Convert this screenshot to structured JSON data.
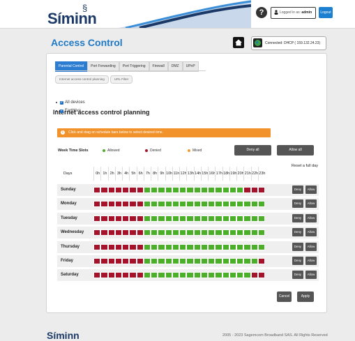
{
  "header": {
    "logo": "Síminn",
    "help": "?",
    "login_prefix": "Logged in as",
    "user": "admin",
    "logout": "Logout"
  },
  "page": {
    "title": "Access Control",
    "connection": "Connected: DHCP ( 159.132.24.23)"
  },
  "tabs": [
    {
      "label": "Parental Control",
      "active": true
    },
    {
      "label": "Port Forwarding",
      "active": false
    },
    {
      "label": "Port Triggering",
      "active": false
    },
    {
      "label": "Firewall",
      "active": false
    },
    {
      "label": "DMZ",
      "active": false
    },
    {
      "label": "UPnP",
      "active": false
    }
  ],
  "subtabs": [
    "Internet access control planning",
    "URL Filter"
  ],
  "section_title": "Internet access control planning",
  "devices": [
    {
      "label": "All devices",
      "checked": true
    },
    {
      "label": "Farthliva",
      "checked": true
    }
  ],
  "warning": "Click and drag on schedule bars below to select desired time.",
  "schedule": {
    "title": "Week Time Slots",
    "legend": [
      {
        "label": "Allowed",
        "color": "#4caf2a"
      },
      {
        "label": "Denied",
        "color": "#a6122a"
      },
      {
        "label": "Mixed",
        "color": "#f29a2e"
      }
    ],
    "deny_all": "Deny all",
    "allow_all": "Allow all",
    "days_header": "Days",
    "reset_header": "Reset a full day",
    "hours": [
      "0h",
      "1h",
      "2h",
      "3h",
      "4h",
      "5h",
      "6h",
      "7h",
      "8h",
      "9h",
      "10h",
      "11h",
      "12h",
      "13h",
      "14h",
      "15h",
      "16h",
      "17h",
      "18h",
      "19h",
      "20h",
      "21h",
      "22h",
      "23h"
    ],
    "colors": {
      "allowed": "#4caf2a",
      "denied": "#a6122a"
    },
    "deny_label": "Deny",
    "allow_label": "Allow",
    "rows": [
      {
        "day": "Sunday",
        "slots": "DDDDDDDAAAAAAAAAAAAAADDD"
      },
      {
        "day": "Monday",
        "slots": "DDDDDDDAAAAAAAAAAAAAAAAA"
      },
      {
        "day": "Tuesday",
        "slots": "DDDDDDDAAAAAAAAAAAAAAAAA"
      },
      {
        "day": "Wednesday",
        "slots": "DDDDDDDAAAAAAAAAAAAAAAAA"
      },
      {
        "day": "Thursday",
        "slots": "DDDDDDDAAAAAAAAAAAAAAAAA"
      },
      {
        "day": "Friday",
        "slots": "DDDDDDDAAAAAAAAAAAAAAAAD"
      },
      {
        "day": "Saturday",
        "slots": "DDDDDDDAAAAAAAAAAAAAAADD"
      }
    ]
  },
  "footer": {
    "cancel": "Cancel",
    "apply": "Apply",
    "logo": "Síminn",
    "copyright": "2005 - 2023 Sagemcom Broadband SAS. All Rights Reserved"
  }
}
